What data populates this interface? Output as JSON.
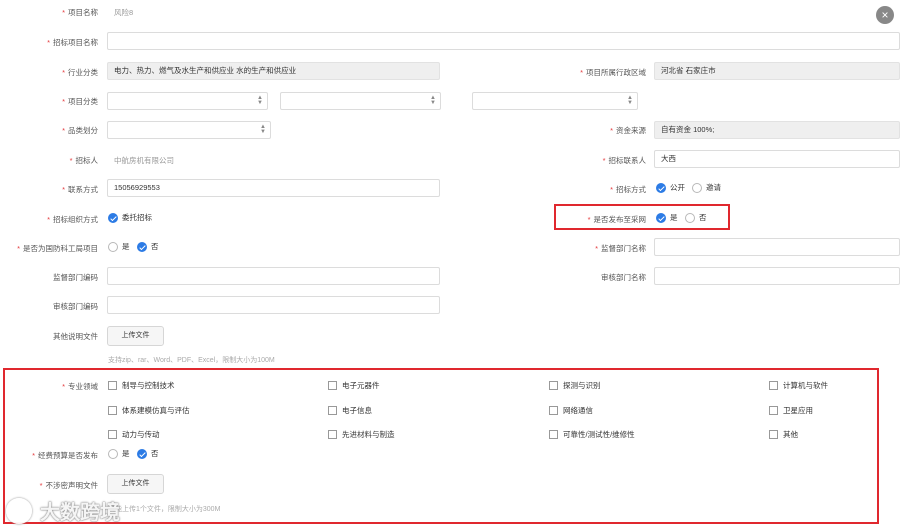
{
  "labels": {
    "project_name": "项目名称",
    "tender_name": "招标项目名称",
    "industry": "行业分类",
    "region": "项目所属行政区域",
    "project_category": "项目分类",
    "category_division": "品类划分",
    "fund_source": "资金来源",
    "tenderee": "招标人",
    "tender_contact": "招标联系人",
    "contact_method": "联系方式",
    "tender_method": "招标方式",
    "organize_method": "招标组织方式",
    "publish_national": "是否发布至采网",
    "defense_project": "是否为国防科工局项目",
    "supervise_name": "监督部门名称",
    "supervise_code": "监督部门编码",
    "approve_name": "审核部门名称",
    "approve_code": "审核部门编码",
    "other_files": "其他说明文件",
    "specialty": "专业领域",
    "budget_publish": "经费预算是否发布",
    "non_secret": "不涉密声明文件"
  },
  "values": {
    "project_name": "风险8",
    "tender_name": "",
    "industry": "电力、热力、燃气及水生产和供应业  水的生产和供应业",
    "region": "河北省  石家庄市",
    "project_category": [
      "",
      "",
      ""
    ],
    "category_division": "",
    "fund_source": "自有资金 100%;",
    "tenderee": "中航房机有限公司",
    "tender_contact": "大西",
    "contact_method": "15056929553",
    "supervise_name": "",
    "supervise_code": "",
    "approve_name": "",
    "approve_code": ""
  },
  "options": {
    "tender_method": [
      "公开",
      "邀请"
    ],
    "organize_method": "委托招标",
    "yes": "是",
    "no": "否"
  },
  "upload": {
    "button": "上传文件",
    "hint_other": "支持zip、rar、Word、PDF、Excel，限制大小为100M",
    "hint_non_secret": "只能上传1个文件，限制大小为300M"
  },
  "specialty_items": [
    "制导与控制技术",
    "电子元器件",
    "探测与识别",
    "计算机与软件",
    "体系建模仿真与评估",
    "电子信息",
    "网络通信",
    "卫星应用",
    "动力与传动",
    "先进材料与制造",
    "可靠性/测试性/维修性",
    "其他"
  ],
  "close_symbol": "×",
  "watermark": "大数跨境",
  "colors": {
    "accent": "#2c7be5",
    "highlight": "#e0282e",
    "required": "#e4393c"
  }
}
